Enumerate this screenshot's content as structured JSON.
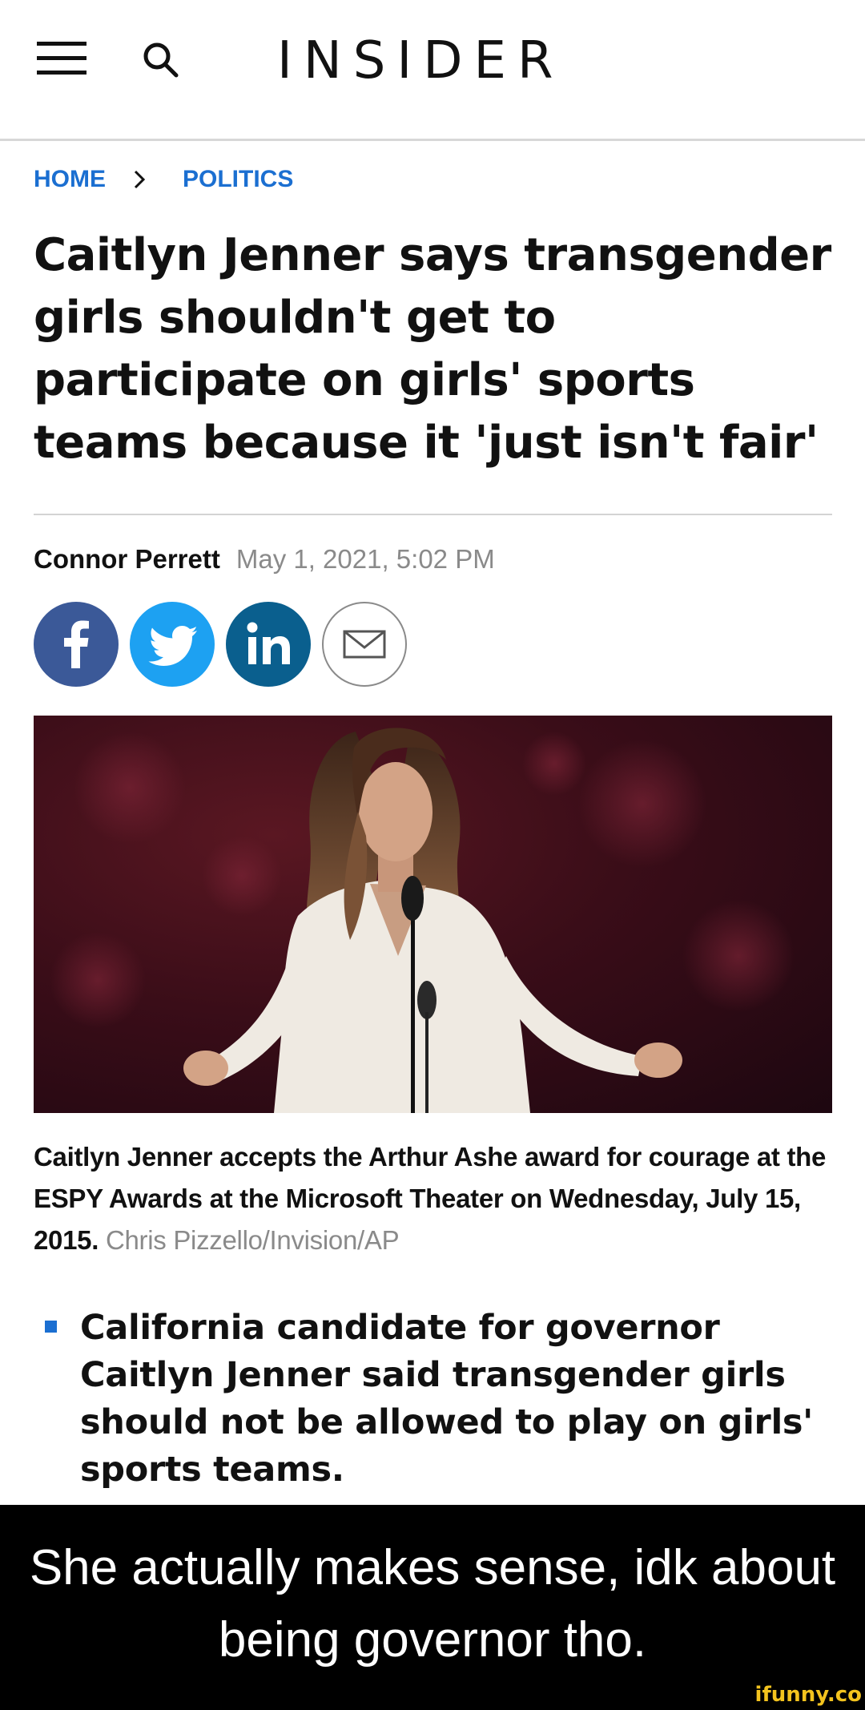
{
  "header": {
    "logo": "INSIDER",
    "menu_icon": "hamburger-menu-icon",
    "search_icon": "search-icon"
  },
  "breadcrumb": {
    "home": "HOME",
    "section": "POLITICS",
    "separator_icon": "chevron-right-icon"
  },
  "article": {
    "headline": "Caitlyn Jenner says transgender girls shouldn't get to participate on girls' sports teams because it 'just isn't fair'",
    "author": "Connor Perrett",
    "date": "May 1, 2021, 5:02 PM",
    "share": {
      "facebook_icon": "facebook-icon",
      "twitter_icon": "twitter-icon",
      "linkedin_icon": "linkedin-icon",
      "email_icon": "email-icon"
    },
    "image": {
      "caption": "Caitlyn Jenner accepts the Arthur Ashe award for courage at the ESPY Awards at the Microsoft Theater on Wednesday, July 15, 2015.",
      "credit": "Chris Pizzello/Invision/AP"
    },
    "bullets": [
      "California candidate for governor Caitlyn Jenner said transgender girls should not be allowed to play on girls' sports teams."
    ]
  },
  "meme": {
    "caption": "She actually makes sense, idk about being governor tho.",
    "watermark": "ifunny.co"
  },
  "colors": {
    "accent_blue": "#1b6fd1",
    "facebook": "#3b5998",
    "twitter": "#1da1f2",
    "linkedin": "#0a5f8e",
    "muted_text": "#8a8a8a",
    "meme_background": "#000000",
    "watermark": "#f3c31e"
  }
}
